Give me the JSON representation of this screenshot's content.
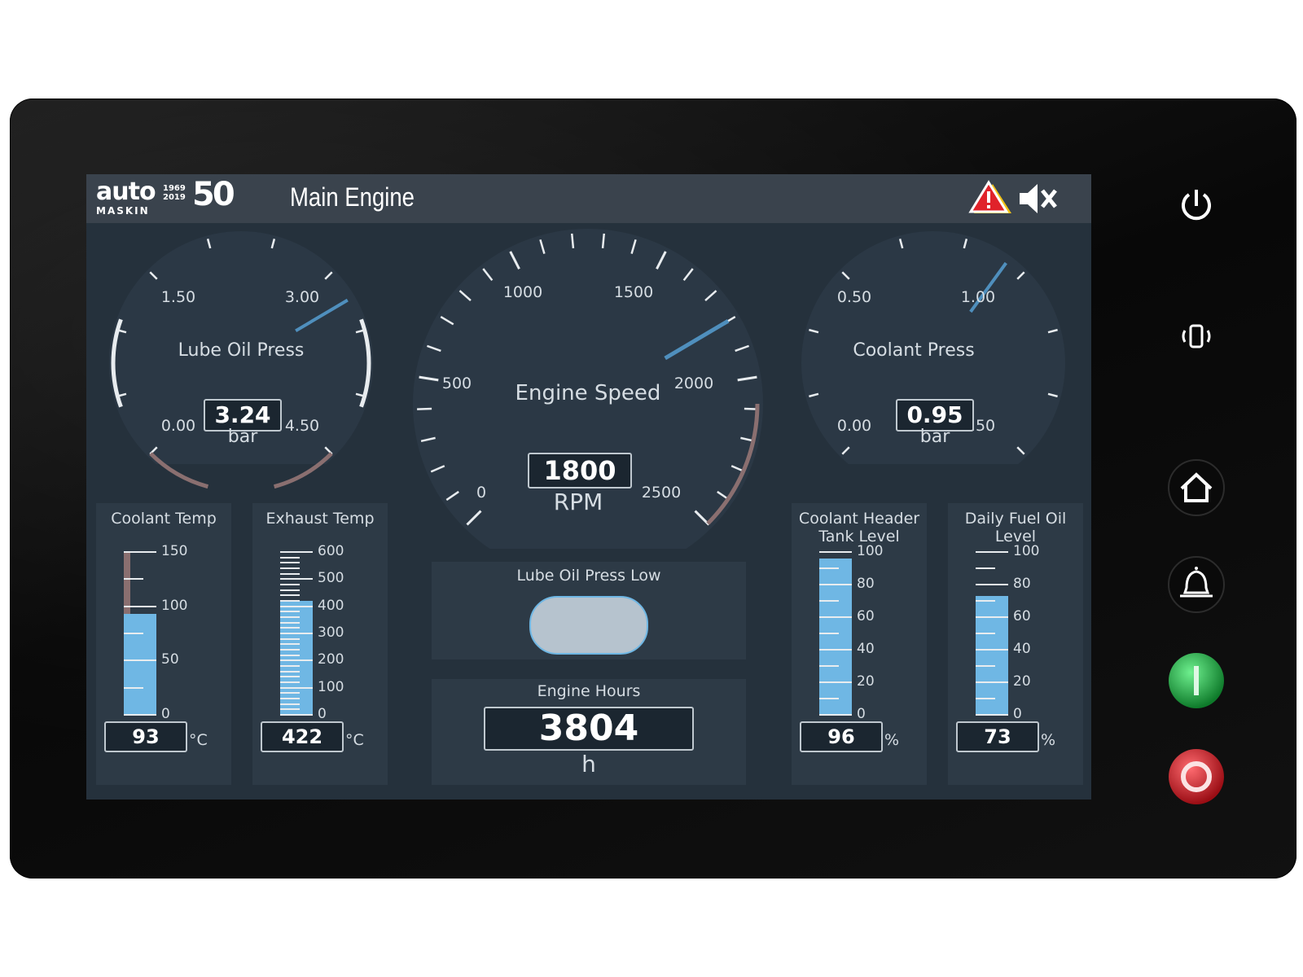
{
  "header": {
    "logo_auto": "auto",
    "logo_maskin": "MASKIN",
    "logo_year_start": "1969",
    "logo_year_end": "2019",
    "logo_anniversary": "50",
    "title": "Main Engine",
    "icons": [
      "alarm-warning-icon",
      "mute-icon"
    ]
  },
  "colors": {
    "screen_bg": "#25313c",
    "header_bg": "#3a434d",
    "bar_fill": "#6fb7e4",
    "needle": "#4f8fbd",
    "warn_arc": "#8a6f70",
    "indicator_off": "#b6c3ce",
    "warning_red": "#e0222a",
    "warning_yellow": "#f2c317",
    "start_green": "#24b34a",
    "stop_red": "#d8222c"
  },
  "gauges": {
    "lube_oil": {
      "label": "Lube Oil Press",
      "value": "3.24",
      "unit": "bar",
      "ticks": [
        "0.00",
        "1.50",
        "3.00",
        "4.50"
      ],
      "min": 0,
      "max": 4.5,
      "reading": 3.24
    },
    "engine_speed": {
      "label": "Engine Speed",
      "value": "1800",
      "unit": "RPM",
      "ticks": [
        "0",
        "500",
        "1000",
        "1500",
        "2000",
        "2500"
      ],
      "min": 0,
      "max": 2500,
      "reading": 1800
    },
    "coolant_press": {
      "label": "Coolant Press",
      "value": "0.95",
      "unit": "bar",
      "ticks": [
        "0.00",
        "0.50",
        "1.00",
        "1.50"
      ],
      "min": 0,
      "max": 1.5,
      "reading": 0.95
    }
  },
  "bars": {
    "coolant_temp": {
      "label": "Coolant Temp",
      "value": "93",
      "unit": "°C",
      "ticks": [
        "150",
        "100",
        "50",
        "0"
      ],
      "level_pct": 62
    },
    "exhaust_temp": {
      "label": "Exhaust Temp",
      "value": "422",
      "unit": "°C",
      "ticks": [
        "600",
        "500",
        "400",
        "300",
        "200",
        "100",
        "0"
      ],
      "level_pct": 70
    },
    "coolant_header": {
      "label_line1": "Coolant Header",
      "label_line2": "Tank Level",
      "value": "96",
      "unit": "%",
      "ticks": [
        "100",
        "80",
        "60",
        "40",
        "20",
        "0"
      ],
      "level_pct": 96
    },
    "fuel_oil": {
      "label_line1": "Daily Fuel Oil",
      "label_line2": "Level",
      "value": "73",
      "unit": "%",
      "ticks": [
        "100",
        "80",
        "60",
        "40",
        "20",
        "0"
      ],
      "level_pct": 73
    }
  },
  "indicator": {
    "label": "Lube Oil Press Low"
  },
  "engine_hours": {
    "label": "Engine Hours",
    "value": "3804",
    "unit": "h"
  },
  "side_buttons": [
    "power-icon",
    "vibrate-icon",
    "home-icon",
    "alarm-bell-icon",
    "start-icon",
    "stop-icon"
  ]
}
